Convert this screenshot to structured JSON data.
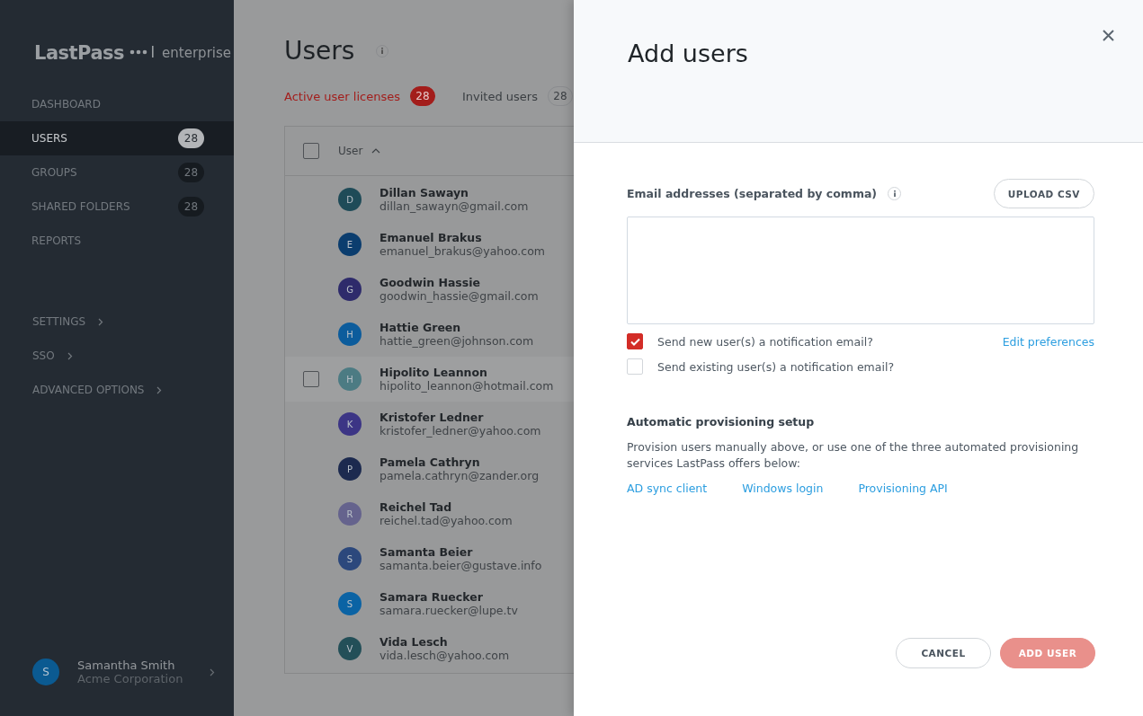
{
  "sidebar": {
    "logo": {
      "brand": "LastPass",
      "product": "enterprise"
    },
    "nav_items": [
      {
        "label": "DASHBOARD",
        "selected": false
      },
      {
        "label": "USERS",
        "count": "28",
        "selected": true
      },
      {
        "label": "GROUPS",
        "count": "28",
        "selected": false
      },
      {
        "label": "SHARED FOLDERS",
        "count": "28",
        "selected": false
      },
      {
        "label": "REPORTS",
        "selected": false
      }
    ],
    "menu_items": [
      {
        "label": "SETTINGS"
      },
      {
        "label": "SSO"
      },
      {
        "label": "ADVANCED OPTIONS"
      }
    ],
    "account": {
      "initial": "S",
      "name": "Samantha Smith",
      "company": "Acme Corporation"
    }
  },
  "page": {
    "title": "Users",
    "tabs": [
      {
        "label": "Active user licenses",
        "count": "28",
        "selected": true
      },
      {
        "label": "Invited users",
        "count": "28",
        "selected": false
      }
    ],
    "table": {
      "select_all": {
        "checked": false
      },
      "column": "User",
      "rows": [
        {
          "initial": "D",
          "name": "Dillan Sawayn",
          "email": "dillan_sawayn@gmail.com",
          "color": "#1f4b58",
          "highlighted": false
        },
        {
          "initial": "E",
          "name": "Emanuel Brakus",
          "email": "emanuel_brakus@yahoo.com",
          "color": "#0b3d6e",
          "highlighted": false
        },
        {
          "initial": "G",
          "name": "Goodwin Hassie",
          "email": "goodwin_hassie@gmail.com",
          "color": "#2e2b6b",
          "highlighted": false
        },
        {
          "initial": "H",
          "name": "Hattie Green",
          "email": "hattie_green@johnson.com",
          "color": "#0c5c9c",
          "highlighted": false
        },
        {
          "initial": "H",
          "name": "Hipolito Leannon",
          "email": "hipolito_leannon@hotmail.com",
          "color": "#4c7b83",
          "highlighted": true
        },
        {
          "initial": "K",
          "name": "Kristofer Ledner",
          "email": "kristofer_ledner@yahoo.com",
          "color": "#3c3585",
          "highlighted": false
        },
        {
          "initial": "P",
          "name": "Pamela Cathryn",
          "email": "pamela.cathryn@zander.org",
          "color": "#1c2a4f",
          "highlighted": false
        },
        {
          "initial": "R",
          "name": "Reichel Tad",
          "email": "reichel.tad@yahoo.com",
          "color": "#65638d",
          "highlighted": false
        },
        {
          "initial": "S",
          "name": "Samanta Beier",
          "email": "samanta.beier@gustave.info",
          "color": "#2c487c",
          "highlighted": false
        },
        {
          "initial": "S",
          "name": "Samara Ruecker",
          "email": "samara.ruecker@lupe.tv",
          "color": "#0b63a4",
          "highlighted": false
        },
        {
          "initial": "V",
          "name": "Vida Lesch",
          "email": "vida.lesch@yahoo.com",
          "color": "#234f58",
          "highlighted": false
        }
      ]
    }
  },
  "drawer": {
    "title": "Add users",
    "email_label": "Email addresses (separated by comma)",
    "upload_button": "UPLOAD CSV",
    "options": [
      {
        "label": "Send new user(s) a notification email?",
        "checked": true,
        "link": "Edit preferences"
      },
      {
        "label": "Send existing user(s) a notification email?",
        "checked": false
      }
    ],
    "provisioning": {
      "title": "Automatic provisioning setup",
      "text": "Provision users manually above, or use one of the three automated provisioning services LastPass offers below:",
      "links": [
        "AD sync client",
        "Windows login",
        "Provisioning API"
      ]
    },
    "buttons": [
      {
        "label": "CANCEL",
        "kind": "secondary"
      },
      {
        "label": "ADD USER",
        "kind": "primary"
      }
    ]
  }
}
